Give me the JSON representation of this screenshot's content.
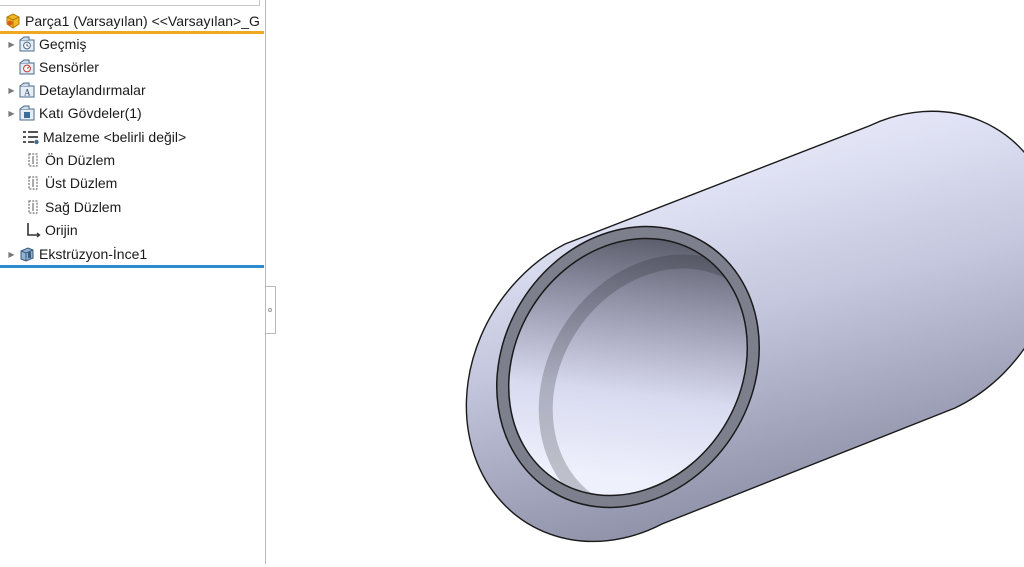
{
  "feature_tree": {
    "root_label": "Parça1 (Varsayılan) <<Varsayılan>_G",
    "root_icon": "part-icon",
    "items": [
      {
        "label": "Geçmiş",
        "icon": "history-icon",
        "expandable": true
      },
      {
        "label": "Sensörler",
        "icon": "sensors-icon",
        "expandable": false
      },
      {
        "label": "Detaylandırmalar",
        "icon": "annotations-icon",
        "expandable": true
      },
      {
        "label": "Katı Gövdeler(1)",
        "icon": "solid-bodies-icon",
        "expandable": true
      },
      {
        "label": "Malzeme <belirli değil>",
        "icon": "material-icon",
        "expandable": false
      },
      {
        "label": "Ön Düzlem",
        "icon": "plane-icon",
        "expandable": false
      },
      {
        "label": "Üst Düzlem",
        "icon": "plane-icon",
        "expandable": false
      },
      {
        "label": "Sağ Düzlem",
        "icon": "plane-icon",
        "expandable": false
      },
      {
        "label": "Orijin",
        "icon": "origin-icon",
        "expandable": false
      },
      {
        "label": "Ekstrüzyon-İnce1",
        "icon": "extrude-feature-icon",
        "expandable": true
      }
    ]
  },
  "colors": {
    "root_underline": "#f0a820",
    "end_of_tree_bar": "#2f8ad0",
    "tube_edge": "#1a1a1a"
  },
  "viewport": {
    "model": "thin-walled-tube-icon"
  }
}
